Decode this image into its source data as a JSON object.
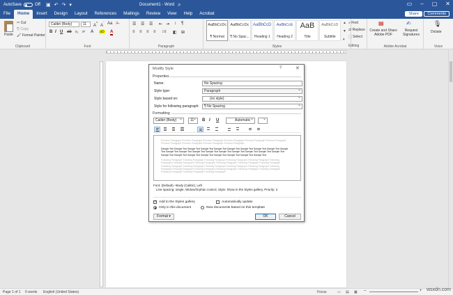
{
  "titlebar": {
    "autosave_label": "AutoSave",
    "autosave_state": "Off",
    "title": "Document1 - Word",
    "search_icon": "search-icon",
    "minimize_icon": "minimize-icon",
    "maximize_icon": "maximize-icon",
    "close_icon": "close-icon"
  },
  "ribbon": {
    "tabs": [
      "File",
      "Home",
      "Insert",
      "Design",
      "Layout",
      "References",
      "Mailings",
      "Review",
      "View",
      "Help",
      "Acrobat"
    ],
    "active_tab": "Home",
    "share_label": "Share",
    "comments_label": "Comments",
    "clipboard": {
      "paste": "Paste",
      "cut": "Cut",
      "copy": "Copy",
      "format_painter": "Format Painter",
      "label": "Clipboard"
    },
    "font": {
      "name": "Calibri (Body)",
      "size": "11",
      "label": "Font"
    },
    "paragraph_label": "Paragraph",
    "styles": {
      "items": [
        {
          "sample": "AaBbCcDc",
          "name": "¶ Normal"
        },
        {
          "sample": "AaBbCcDc",
          "name": "¶ No Spac..."
        },
        {
          "sample": "AaBbCcD",
          "name": "Heading 1"
        },
        {
          "sample": "AaBbCcE",
          "name": "Heading 2"
        },
        {
          "sample": "AaB",
          "name": "Title"
        },
        {
          "sample": "AaBbCcD",
          "name": "Subtitle"
        }
      ],
      "label": "Styles"
    },
    "editing": {
      "find": "Find",
      "replace": "Replace",
      "select": "Select",
      "label": "Editing"
    },
    "acrobat": {
      "create_share": "Create and Share Adobe PDF",
      "request_sig": "Request Signatures",
      "label": "Adobe Acrobat"
    },
    "voice": {
      "dictate": "Dictate",
      "label": "Voice"
    }
  },
  "dialog": {
    "title": "Modify Style",
    "help": "?",
    "properties_label": "Properties",
    "name_label": "Name:",
    "name_value": "No Spacing",
    "style_type_label": "Style type:",
    "style_type_value": "Paragraph",
    "based_on_label": "Style based on:",
    "based_on_value": "(no style)",
    "following_label": "Style for following paragraph:",
    "following_value": "¶  No Spacing",
    "formatting_label": "Formatting",
    "fmt_font": "Calibri (Body)",
    "fmt_size": "11",
    "fmt_bold": "B",
    "fmt_italic": "I",
    "fmt_underline": "U",
    "fmt_color": "Automatic",
    "preview_prev": "Previous Paragraph Previous Paragraph Previous Paragraph Previous Paragraph Previous Paragraph Previous Paragraph Previous Paragraph Previous Paragraph Previous Paragraph Previous Paragraph",
    "preview_sample": "Sample Text Sample Text Sample Text Sample Text Sample Text Sample Text Sample Text Sample Text Sample Text Sample Text Sample Text Sample Text Sample Text Sample Text Sample Text Sample Text Sample Text Sample Text Sample Text Sample Text Sample Text Sample Text Sample Text Sample Text Sample Text Sample Text Sample Text",
    "preview_follow": "Following Paragraph Following Paragraph Following Paragraph Following Paragraph Following Paragraph Following Paragraph Following Paragraph Following Paragraph Following Paragraph Following Paragraph Following Paragraph Following Paragraph Following Paragraph Following Paragraph Following Paragraph Following Paragraph Following Paragraph Following Paragraph Following Paragraph Following Paragraph Following Paragraph Following Paragraph Following Paragraph Following Paragraph Following Paragraph",
    "desc_line1": "Font: (Default) +Body (Calibri), Left",
    "desc_line2": "Line spacing:  single, Widow/Orphan control, Style: Show in the Styles gallery, Priority: 2",
    "add_gallery": "Add to the Styles gallery",
    "auto_update": "Automatically update",
    "only_doc": "Only in this document",
    "new_docs": "New documents based on this template",
    "format_btn": "Format ▾",
    "ok": "OK",
    "cancel": "Cancel"
  },
  "status": {
    "page": "Page 1 of 1",
    "words": "0 words",
    "language": "English (United States)",
    "focus": "Focus",
    "watermark": "wsxdn.com"
  }
}
